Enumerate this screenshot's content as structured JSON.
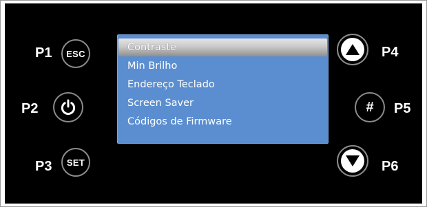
{
  "labels": {
    "p1": "P1",
    "p2": "P2",
    "p3": "P3",
    "p4": "P4",
    "p5": "P5",
    "p6": "P6"
  },
  "buttons": {
    "esc": "ESC",
    "set": "SET",
    "hash": "#",
    "power_icon": "power-icon",
    "up_icon": "triangle-up-icon",
    "down_icon": "triangle-down-icon"
  },
  "menu": {
    "items": [
      {
        "label": "Contraste",
        "selected": true
      },
      {
        "label": "Min Brilho",
        "selected": false
      },
      {
        "label": "Endereço Teclado",
        "selected": false
      },
      {
        "label": "Screen Saver",
        "selected": false
      },
      {
        "label": "Códigos de Firmware",
        "selected": false
      }
    ]
  },
  "colors": {
    "panel": "#000000",
    "screen": "#5b8ed0",
    "button_ring": "#8c8c8c",
    "selection": "#c9c9c9"
  }
}
